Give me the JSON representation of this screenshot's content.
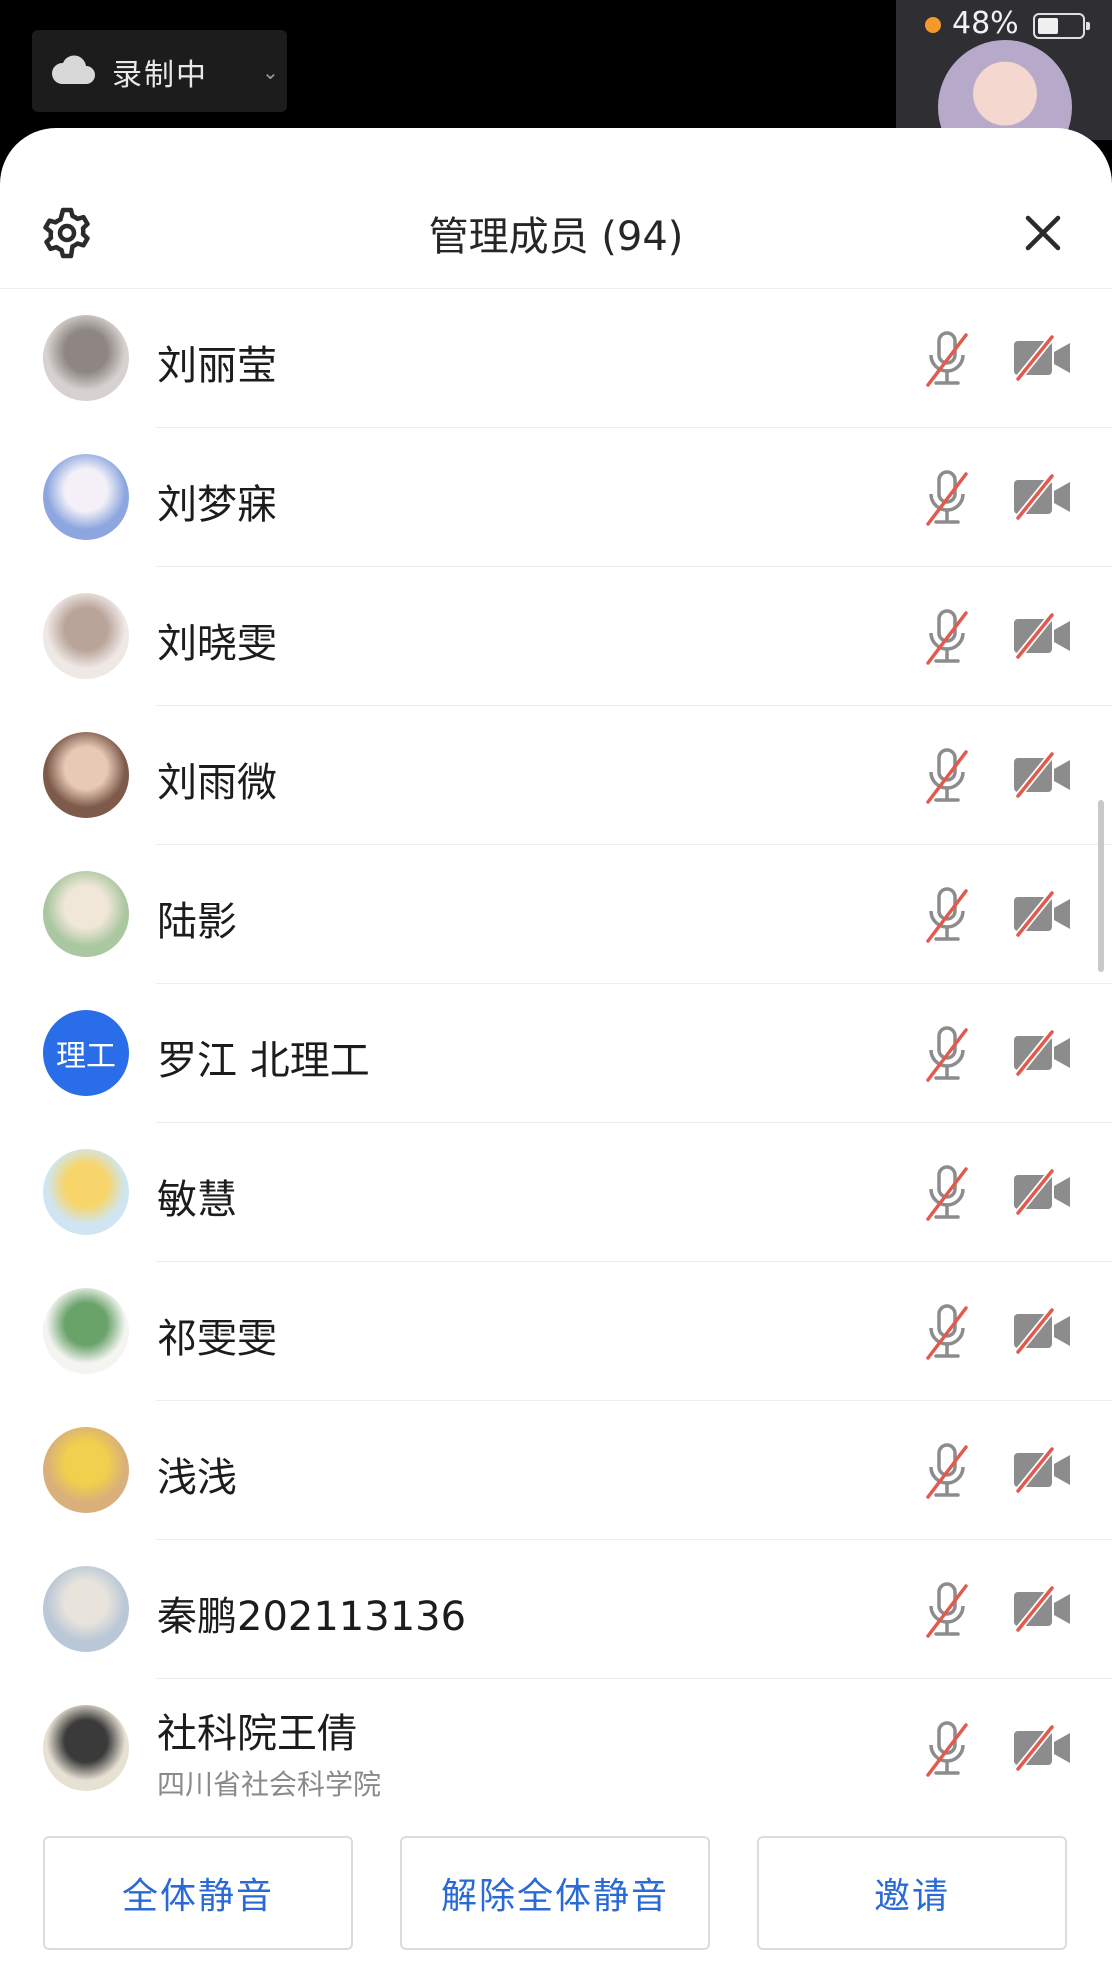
{
  "status": {
    "recording_label": "录制中",
    "battery_percent": "48%"
  },
  "panel": {
    "title": "管理成员 (94)",
    "settings_icon": "gear-icon",
    "close_icon": "close-icon"
  },
  "members": [
    {
      "name": "刘丽莹",
      "avatar": "photo-cat",
      "muted": true,
      "video_off": true
    },
    {
      "name": "刘梦寐",
      "avatar": "photo-bunny",
      "muted": true,
      "video_off": true
    },
    {
      "name": "刘晓雯",
      "avatar": "photo-woman",
      "muted": true,
      "video_off": true
    },
    {
      "name": "刘雨微",
      "avatar": "photo-girl",
      "muted": true,
      "video_off": true
    },
    {
      "name": "陆影",
      "avatar": "photo-garden",
      "muted": true,
      "video_off": true
    },
    {
      "name": "罗江 北理工",
      "avatar_text": "理工",
      "muted": true,
      "video_off": true
    },
    {
      "name": "敏慧",
      "avatar": "photo-cartoon",
      "muted": true,
      "video_off": true
    },
    {
      "name": "祁雯雯",
      "avatar": "photo-plant",
      "muted": true,
      "video_off": true
    },
    {
      "name": "浅浅",
      "avatar": "photo-sunglasses",
      "muted": true,
      "video_off": true
    },
    {
      "name": "秦鹏202113136",
      "avatar": "photo-painting",
      "muted": true,
      "video_off": true
    },
    {
      "name": "社科院王倩",
      "subtitle": "四川省社会科学院",
      "avatar": "photo-art",
      "muted": true,
      "video_off": true
    }
  ],
  "footer": {
    "mute_all": "全体静音",
    "unmute_all": "解除全体静音",
    "invite": "邀请"
  },
  "colors": {
    "accent": "#2a6ad6",
    "muted_slash": "#e05a4f",
    "icon_gray": "#8c8c8c",
    "avatar_blue": "#2a6de8"
  }
}
